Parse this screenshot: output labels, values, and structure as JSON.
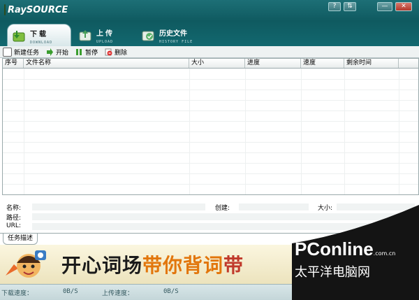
{
  "app": {
    "logo_text": "RaySOURCE"
  },
  "window_controls": [
    "?",
    "⇅",
    "—",
    "✕"
  ],
  "tabs": [
    {
      "label": "下载",
      "sub": "DOWNLOAD"
    },
    {
      "label": "上传",
      "sub": "UPLOAD"
    },
    {
      "label": "历史文件",
      "sub": "HISTORY FILE"
    }
  ],
  "toolbar": {
    "new_task": "新建任务",
    "start": "开始",
    "pause": "暂停",
    "delete": "删除"
  },
  "table": {
    "columns": [
      "序号",
      "文件名称",
      "大小",
      "进度",
      "速度",
      "剩余时间"
    ]
  },
  "details": {
    "name_label": "名称:",
    "created_label": "创建:",
    "size_label": "大小:",
    "path_label": "路径:",
    "url_label": "URL:"
  },
  "description_tab": "任务描述",
  "banner": {
    "part1": "开心词场",
    "part2": "带你背词",
    "part3": "带"
  },
  "status": {
    "download_label": "下载速度：",
    "download_value": "0B/S",
    "upload_label": "上传速度：",
    "upload_value": "0B/S"
  },
  "watermark": {
    "brand": "PConline",
    "domain": ".com.cn",
    "chinese": "太平洋电脑网"
  },
  "colors": {
    "titlebar": "#0f5a60",
    "banner_part1": "#1b1b1b",
    "banner_part2": "#e2760c",
    "banner_part3": "#c0392b"
  }
}
